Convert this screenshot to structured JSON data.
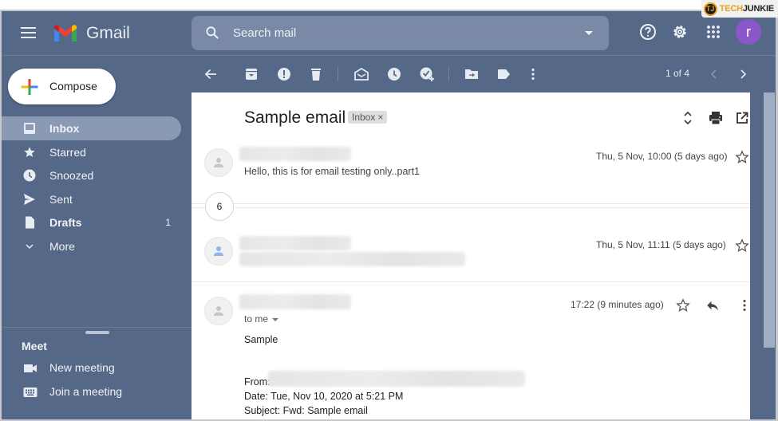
{
  "watermark": {
    "logo_letter": "TJ",
    "text_accent": "TECH",
    "text_main": "JUNKIE"
  },
  "header": {
    "app_name": "Gmail",
    "search_placeholder": "Search mail",
    "avatar_letter": "r",
    "icons": [
      "menu-icon",
      "help-icon",
      "settings-icon",
      "apps-icon"
    ]
  },
  "sidebar": {
    "compose_label": "Compose",
    "items": [
      {
        "label": "Inbox",
        "icon": "inbox-icon",
        "active": true,
        "bold": true,
        "count": ""
      },
      {
        "label": "Starred",
        "icon": "star-icon",
        "active": false,
        "bold": false,
        "count": ""
      },
      {
        "label": "Snoozed",
        "icon": "clock-icon",
        "active": false,
        "bold": false,
        "count": ""
      },
      {
        "label": "Sent",
        "icon": "send-icon",
        "active": false,
        "bold": false,
        "count": ""
      },
      {
        "label": "Drafts",
        "icon": "draft-icon",
        "active": false,
        "bold": true,
        "count": "1"
      },
      {
        "label": "More",
        "icon": "chevron-down-icon",
        "active": false,
        "bold": false,
        "count": ""
      }
    ],
    "meet": {
      "title": "Meet",
      "items": [
        {
          "label": "New meeting",
          "icon": "video-camera-icon"
        },
        {
          "label": "Join a meeting",
          "icon": "keyboard-icon"
        }
      ]
    }
  },
  "toolbar": {
    "icons": [
      "back-arrow-icon",
      "archive-icon",
      "report-spam-icon",
      "delete-icon",
      "mark-unread-icon",
      "snooze-icon",
      "add-task-icon",
      "move-to-icon",
      "label-icon",
      "more-vert-icon"
    ],
    "pager": "1 of 4"
  },
  "thread": {
    "subject": "Sample email",
    "label": "Inbox",
    "collapsed_count": "6",
    "messages": [
      {
        "snippet": "Hello, this is for email testing only..part1",
        "date": "Thu, 5 Nov, 10:00 (5 days ago)"
      },
      {
        "snippet": "",
        "date": "Thu, 5 Nov, 11:11 (5 days ago)"
      },
      {
        "date": "17:22 (9 minutes ago)",
        "to_label": "to me",
        "body": {
          "greeting": "Sample",
          "from_label": "From:",
          "date_line": "Date: Tue, Nov 10, 2020 at 5:21 PM",
          "subject_line": "Subject: Fwd: Sample email"
        }
      }
    ]
  }
}
